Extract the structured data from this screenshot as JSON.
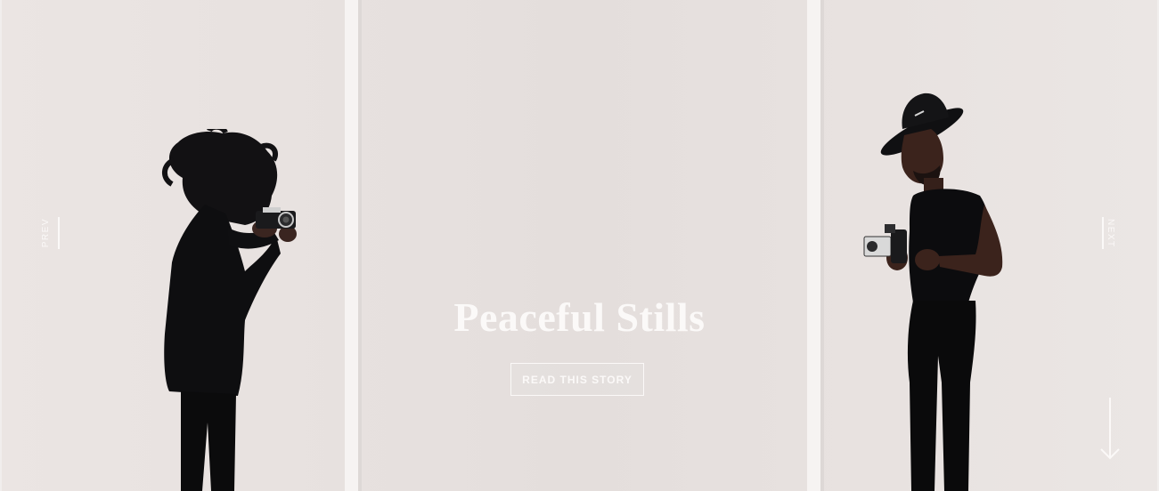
{
  "hero": {
    "title": "Peaceful Stills",
    "cta_label": "READ THIS STORY"
  },
  "nav": {
    "prev_label": "PREV",
    "next_label": "NEXT"
  },
  "icons": {
    "scroll": "arrow-down-icon"
  },
  "colors": {
    "text": "#fbf9f8",
    "background": "#e7e1df",
    "figure": "#0d0d0f"
  }
}
